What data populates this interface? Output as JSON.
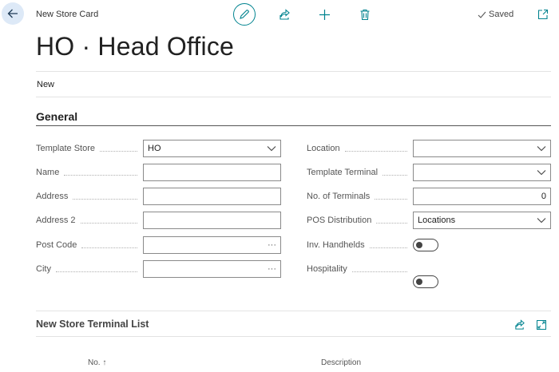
{
  "header": {
    "caption": "New Store Card",
    "saved_label": "Saved"
  },
  "title": "HO · Head Office",
  "actions": {
    "new_label": "New"
  },
  "general": {
    "title": "General",
    "left_fields": [
      {
        "label": "Template Store",
        "value": "HO",
        "kind": "dropdown"
      },
      {
        "label": "Name",
        "value": "",
        "kind": "text"
      },
      {
        "label": "Address",
        "value": "",
        "kind": "text"
      },
      {
        "label": "Address 2",
        "value": "",
        "kind": "text"
      },
      {
        "label": "Post Code",
        "value": "",
        "kind": "lookup",
        "suffix": "···"
      },
      {
        "label": "City",
        "value": "",
        "kind": "lookup",
        "suffix": "···"
      }
    ],
    "right_fields": [
      {
        "label": "Location",
        "value": "",
        "kind": "dropdown"
      },
      {
        "label": "Template Terminal",
        "value": "",
        "kind": "dropdown"
      },
      {
        "label": "No. of Terminals",
        "value": "0",
        "kind": "number"
      },
      {
        "label": "POS Distribution",
        "value": "Locations",
        "kind": "dropdown"
      },
      {
        "label": "Inv. Handhelds",
        "value": false,
        "kind": "toggle"
      },
      {
        "label": "Hospitality",
        "value": false,
        "kind": "toggle"
      }
    ]
  },
  "terminal_list": {
    "title": "New Store Terminal List",
    "columns": [
      {
        "label": "No.",
        "sort_indicator": "↑"
      },
      {
        "label": "Description"
      }
    ]
  },
  "colors": {
    "accent": "#00838f",
    "back_button_bg": "#dde9f7"
  }
}
